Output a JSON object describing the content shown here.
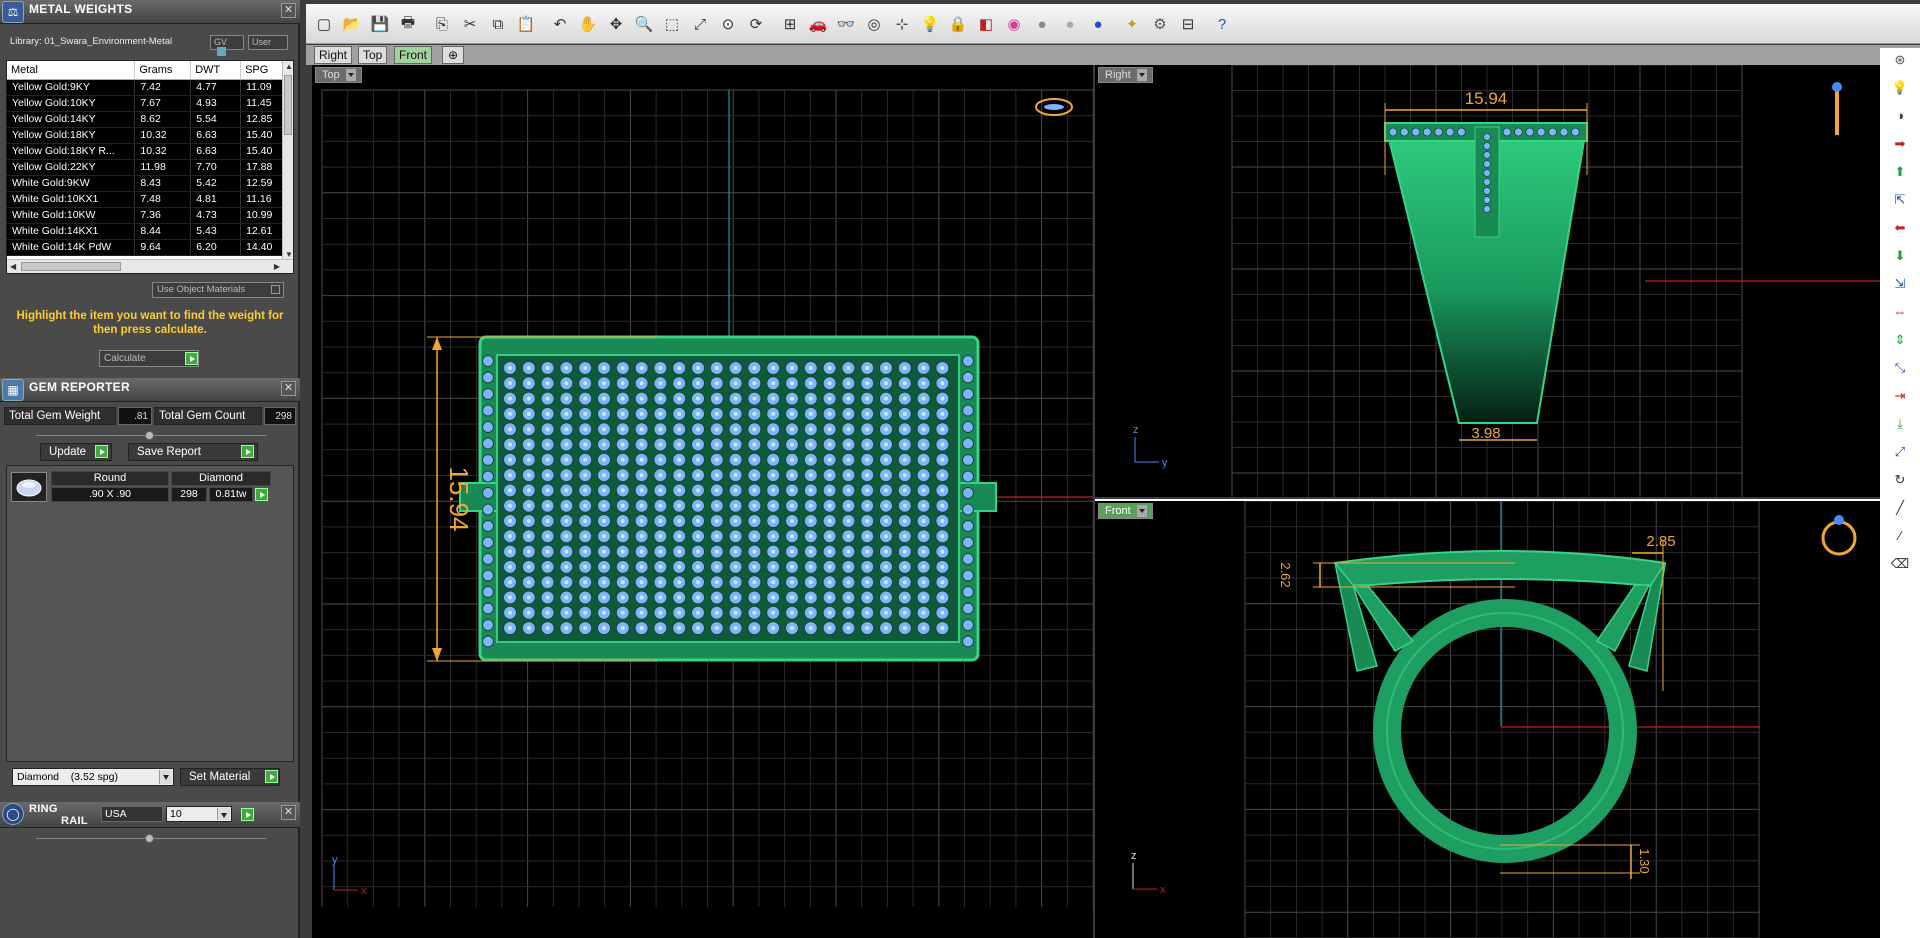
{
  "metal_weights": {
    "title": "METAL WEIGHTS",
    "library_label": "Library: 01_Swara_Environment-Metal",
    "gv_label": "GV",
    "user_label": "User",
    "columns": [
      "Metal",
      "Grams",
      "DWT",
      "SPG"
    ],
    "rows": [
      [
        "Yellow Gold:9KY",
        "7.42",
        "4.77",
        "11.09"
      ],
      [
        "Yellow Gold:10KY",
        "7.67",
        "4.93",
        "11.45"
      ],
      [
        "Yellow Gold:14KY",
        "8.62",
        "5.54",
        "12.85"
      ],
      [
        "Yellow Gold:18KY",
        "10.32",
        "6.63",
        "15.40"
      ],
      [
        "Yellow Gold:18KY R...",
        "10.32",
        "6.63",
        "15.40"
      ],
      [
        "Yellow Gold:22KY",
        "11.98",
        "7.70",
        "17.88"
      ],
      [
        "White Gold:9KW",
        "8.43",
        "5.42",
        "12.59"
      ],
      [
        "White Gold:10KX1",
        "7.48",
        "4.81",
        "11.16"
      ],
      [
        "White Gold:10KW",
        "7.36",
        "4.73",
        "10.99"
      ],
      [
        "White Gold:14KX1",
        "8.44",
        "5.43",
        "12.61"
      ],
      [
        "White Gold:14K PdW",
        "9.64",
        "6.20",
        "14.40"
      ]
    ],
    "use_object_materials": "Use Object Materials",
    "hint": "Highlight the item you want to find the weight for then press calculate.",
    "calculate": "Calculate"
  },
  "gem_reporter": {
    "title": "GEM REPORTER",
    "total_weight_label": "Total Gem Weight",
    "total_weight": ".81",
    "total_count_label": "Total Gem Count",
    "total_count": "298",
    "update_label": "Update",
    "save_report_label": "Save Report",
    "gems": [
      {
        "shape": "Round",
        "size": ".90 X .90",
        "material": "Diamond",
        "count": "298",
        "weight": "0.81tw"
      }
    ],
    "material_select": "Diamond    (3.52 spg)",
    "set_material_label": "Set Material"
  },
  "ring_rail": {
    "title_line1": "RING",
    "title_line2": "RAIL",
    "region": "USA",
    "size": "10"
  },
  "tabs": [
    "Right",
    "Top",
    "Front"
  ],
  "active_tab": "Front",
  "viewports": {
    "top": {
      "label": "Top",
      "dimension": "15.94",
      "axis_v": "y",
      "axis_h": "x"
    },
    "right": {
      "label": "Right",
      "dim_top": "15.94",
      "dim_bottom": "3.98",
      "axis_v": "z",
      "axis_h": "y"
    },
    "front": {
      "label": "Front",
      "dim_left": "2.62",
      "dim_right": "2.85",
      "dim_bottom": "1.30",
      "axis_v": "z",
      "axis_h": "x"
    }
  },
  "colors": {
    "metal": "#1f9e62",
    "metal_light": "#2fcf7f",
    "gem": "#7db3ff",
    "dimension": "#f0a830",
    "grid": "#3a3a3a",
    "axis_v": "#1a9aa6",
    "axis_h": "#c02020",
    "hint": "#ffcc33"
  },
  "toolbar_icons": [
    "new-icon",
    "open-icon",
    "save-icon",
    "print-icon",
    "copy-doc-icon",
    "cut-icon",
    "copy-icon",
    "paste-icon",
    "undo-icon",
    "pan-hand-icon",
    "move-icon",
    "zoom-icon",
    "zoom-window-icon",
    "zoom-extents-icon",
    "zoom-selected-icon",
    "rotate-view-icon",
    "four-views-icon",
    "car-icon",
    "glasses-icon",
    "orbit-icon",
    "snap-icon",
    "light-icon",
    "lock-icon",
    "material-icon",
    "color-wheel-icon",
    "sphere-shade-icon",
    "sphere-metal-icon",
    "sphere-blue-icon",
    "wand-icon",
    "gear-icon",
    "grid-snap-icon",
    "help-icon"
  ]
}
